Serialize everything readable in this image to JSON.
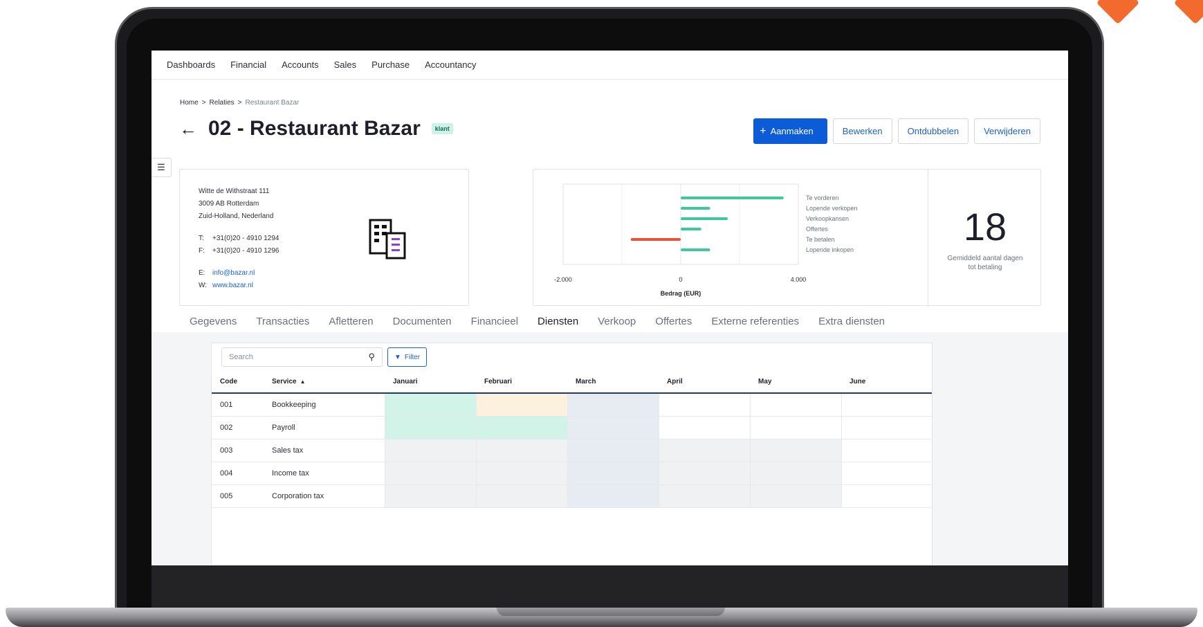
{
  "nav": [
    "Dashboards",
    "Financial",
    "Accounts",
    "Sales",
    "Purchase",
    "Accountancy"
  ],
  "breadcrumb": {
    "home": "Home",
    "sep": ">",
    "relaties": "Relaties",
    "current": "Restaurant Bazar"
  },
  "page": {
    "title": "02 - Restaurant Bazar",
    "badge": "klant"
  },
  "actions": {
    "create": "Aanmaken",
    "edit": "Bewerken",
    "dedupe": "Ontdubbelen",
    "delete": "Verwijderen"
  },
  "address": {
    "street": "Witte de Withstraat 111",
    "city": "3009 AB Rotterdam",
    "region": "Zuid-Holland, Nederland",
    "phone_label": "T:",
    "phone": "+31(0)20 - 4910 1294",
    "fax_label": "F:",
    "fax": "+31(0)20 - 4910 1296",
    "email_label": "E:",
    "email": "info@bazar.nl",
    "web_label": "W:",
    "web": "www.bazar.nl"
  },
  "chart_data": {
    "type": "bar",
    "orientation": "horizontal",
    "categories": [
      "Te vorderen",
      "Lopende verkopen",
      "Verkoopkansen",
      "Offertes",
      "Te betalen",
      "Lopende inkopen"
    ],
    "values": [
      3500,
      1000,
      1600,
      700,
      -1700,
      1000
    ],
    "colors": [
      "#3fc99a",
      "#3fc99a",
      "#3fc99a",
      "#3fc99a",
      "#e8533a",
      "#3fc99a"
    ],
    "xlabel": "Bedrag (EUR)",
    "xlim": [
      -4000,
      4000
    ],
    "ticks": [
      {
        "value": -4000,
        "label": "-2.000"
      },
      {
        "value": 0,
        "label": "0"
      },
      {
        "value": 4000,
        "label": "4.000"
      }
    ],
    "gridlines": [
      -2000,
      2000
    ],
    "legend": "right"
  },
  "kpi": {
    "value": "18",
    "label": "Gemiddeld aantal dagen tot betaling"
  },
  "tabs": [
    "Gegevens",
    "Transacties",
    "Afletteren",
    "Documenten",
    "Financieel",
    "Diensten",
    "Verkoop",
    "Offertes",
    "Externe referenties",
    "Extra diensten"
  ],
  "active_tab": "Diensten",
  "services": {
    "search_placeholder": "Search",
    "filter_label": "Filter",
    "columns": [
      "Code",
      "Service",
      "Januari",
      "Februari",
      "March",
      "April",
      "May",
      "June"
    ],
    "sort_column": "Service",
    "rows": [
      {
        "code": "001",
        "service": "Bookkeeping",
        "months": [
          "green",
          "yellow",
          "blue",
          "white",
          "white",
          "white"
        ]
      },
      {
        "code": "002",
        "service": "Payroll",
        "months": [
          "green",
          "green",
          "blue",
          "white",
          "white",
          "white"
        ]
      },
      {
        "code": "003",
        "service": "Sales tax",
        "months": [
          "grey",
          "grey",
          "blue",
          "grey",
          "grey",
          "white"
        ]
      },
      {
        "code": "004",
        "service": "Income tax",
        "months": [
          "grey",
          "grey",
          "blue",
          "grey",
          "grey",
          "white"
        ]
      },
      {
        "code": "005",
        "service": "Corporation tax",
        "months": [
          "grey",
          "grey",
          "blue",
          "grey",
          "grey",
          "white"
        ]
      }
    ]
  }
}
